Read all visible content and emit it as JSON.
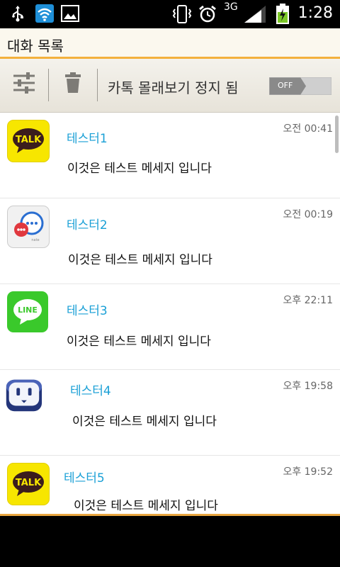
{
  "statusbar": {
    "time": "1:28",
    "network": "3G",
    "icons": [
      "usb-icon",
      "wifi-icon",
      "image-icon",
      "vibrate-icon",
      "alarm-icon",
      "signal-icon",
      "battery-charging-icon"
    ]
  },
  "header": {
    "title": "대화 목록"
  },
  "toolbar": {
    "settings_icon": "sliders-icon",
    "delete_icon": "trash-icon",
    "status_label": "카톡 몰래보기 정지 됨",
    "toggle_label": "OFF"
  },
  "conversations": [
    {
      "app": "KakaoTalk",
      "name": "테스터1",
      "time": "오전 00:41",
      "message": "이것은 테스트 메세지 입니다"
    },
    {
      "app": "NateOn",
      "name": "테스터2",
      "time": "오전 00:19",
      "message": "이것은 테스트 메세지 입니다"
    },
    {
      "app": "LINE",
      "name": "테스터3",
      "time": "오후 22:11",
      "message": "이것은 테스트 메세지 입니다"
    },
    {
      "app": "Messenger",
      "name": "테스터4",
      "time": "오후 19:58",
      "message": "이것은 테스트 메세지 입니다"
    },
    {
      "app": "KakaoTalk",
      "name": "테스터5",
      "time": "오후 19:52",
      "message": "이것은 테스트 메세지 입니다"
    }
  ],
  "colors": {
    "accent": "#f3b13c",
    "name_text": "#1aa0d6",
    "kakao_yellow": "#f7e600",
    "line_green": "#3ac92b"
  }
}
